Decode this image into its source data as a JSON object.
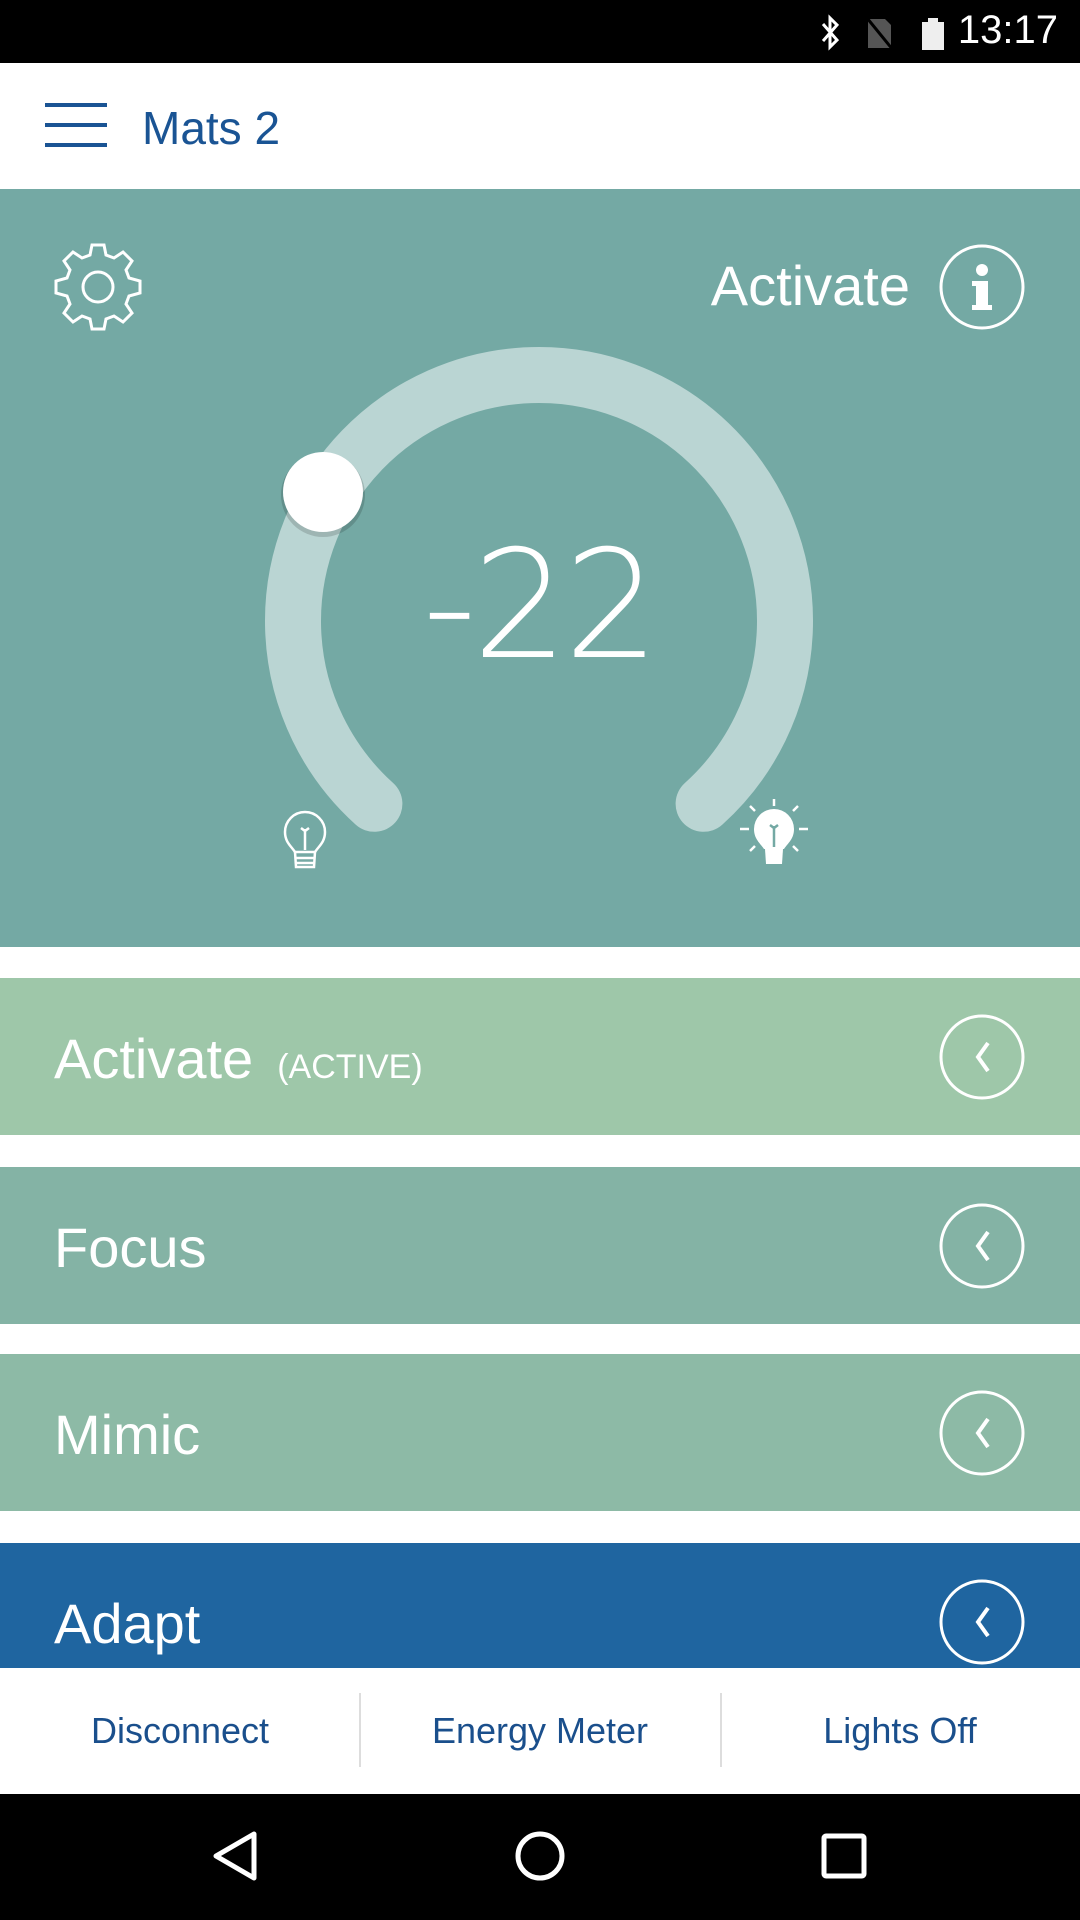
{
  "status_bar": {
    "time": "13:17",
    "icons": [
      "bluetooth-icon",
      "no-sim-icon",
      "battery-icon"
    ]
  },
  "header": {
    "title": "Mats 2",
    "menu_icon": "hamburger-icon"
  },
  "control": {
    "mode_label": "Activate",
    "value": "-22",
    "slider_min_icon": "bulb-off-icon",
    "slider_max_icon": "bulb-on-icon",
    "colors": {
      "panel": "#74a9a4",
      "track": "#bad5d3"
    }
  },
  "modes": [
    {
      "label": "Activate",
      "status": "(ACTIVE)",
      "color": "#9ec7a9"
    },
    {
      "label": "Focus",
      "color": "#84b3a5"
    },
    {
      "label": "Mimic",
      "color": "#8dbaa6"
    },
    {
      "label": "Adapt",
      "color": "#1f65a0"
    }
  ],
  "bottom_bar": {
    "disconnect": "Disconnect",
    "energy_meter": "Energy Meter",
    "lights_off": "Lights Off"
  }
}
